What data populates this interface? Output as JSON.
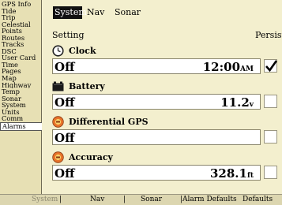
{
  "sidebar": {
    "items": [
      {
        "label": "GPS Info"
      },
      {
        "label": "Tide"
      },
      {
        "label": "Trip"
      },
      {
        "label": "Celestial"
      },
      {
        "label": "Points"
      },
      {
        "label": "Routes"
      },
      {
        "label": "Tracks"
      },
      {
        "label": "DSC"
      },
      {
        "label": "User Card"
      },
      {
        "label": "Time"
      },
      {
        "label": "Pages"
      },
      {
        "label": "Map"
      },
      {
        "label": "Highway"
      },
      {
        "label": "Temp"
      },
      {
        "label": "Sonar"
      },
      {
        "label": "System"
      },
      {
        "label": "Units"
      },
      {
        "label": "Comm"
      },
      {
        "label": "Alarms"
      }
    ],
    "selected": "Alarms"
  },
  "tabs": [
    {
      "label": "System",
      "active": true
    },
    {
      "label": "Nav"
    },
    {
      "label": "Sonar"
    }
  ],
  "headers": {
    "setting": "Setting",
    "persist": "Persist"
  },
  "alarms": [
    {
      "title": "Clock",
      "icon": "clock-icon",
      "value": "Off",
      "reading": "12:00",
      "unit": "AM",
      "persist": true
    },
    {
      "title": "Battery",
      "icon": "battery-icon",
      "value": "Off",
      "reading": "11.2",
      "unit": "v",
      "persist": false
    },
    {
      "title": "Differential GPS",
      "icon": "dgps-icon",
      "value": "Off",
      "reading": "",
      "unit": "",
      "persist": false
    },
    {
      "title": "Accuracy",
      "icon": "accuracy-icon",
      "value": "Off",
      "reading": "328.1",
      "unit": "ft",
      "persist": false
    }
  ],
  "bottom_menu": [
    {
      "label": "System",
      "enabled": false
    },
    {
      "label": "Nav",
      "enabled": true
    },
    {
      "label": "Sonar",
      "enabled": true
    },
    {
      "label": "Alarm Defaults",
      "enabled": true
    },
    {
      "label": "Defaults",
      "enabled": true
    }
  ],
  "colors": {
    "background": "#f3efce",
    "sidebar": "#e7e0b4",
    "tab_active": "#111111",
    "icon_orange": "#e8732a"
  }
}
